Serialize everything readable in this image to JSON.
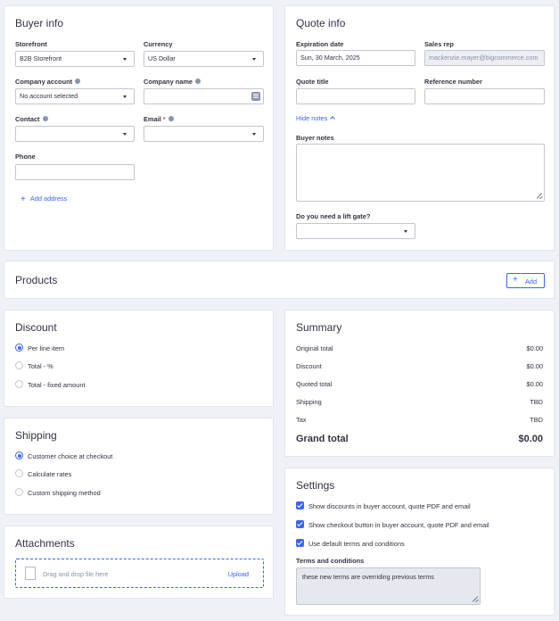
{
  "buyer_info": {
    "title": "Buyer info",
    "storefront": {
      "label": "Storefront",
      "value": "B2B Storefront"
    },
    "currency": {
      "label": "Currency",
      "value": "US Dollar"
    },
    "company_account": {
      "label": "Company account",
      "value": "No account selected"
    },
    "company_name": {
      "label": "Company name",
      "value": ""
    },
    "contact": {
      "label": "Contact",
      "value": ""
    },
    "email": {
      "label": "Email",
      "required_mark": "*",
      "value": ""
    },
    "phone": {
      "label": "Phone",
      "value": ""
    },
    "add_address": "Add address"
  },
  "quote_info": {
    "title": "Quote info",
    "expiration": {
      "label": "Expiration date",
      "value": "Sun, 30 March, 2025"
    },
    "sales_rep": {
      "label": "Sales rep",
      "value": "mackenzie.mayer@bigcommerce.com"
    },
    "quote_title": {
      "label": "Quote title",
      "value": ""
    },
    "reference": {
      "label": "Reference number",
      "value": ""
    },
    "hide_notes": "Hide notes",
    "buyer_notes": {
      "label": "Buyer notes",
      "value": ""
    },
    "lift_gate": {
      "label": "Do you need a lift gate?",
      "value": ""
    }
  },
  "products": {
    "title": "Products",
    "add_label": "Add"
  },
  "discount": {
    "title": "Discount",
    "options": [
      "Per line item",
      "Total - %",
      "Total - fixed amount"
    ],
    "selected": 0
  },
  "summary": {
    "title": "Summary",
    "rows": [
      {
        "label": "Original total",
        "value": "$0.00"
      },
      {
        "label": "Discount",
        "value": "$0.00"
      },
      {
        "label": "Quoted total",
        "value": "$0.00"
      },
      {
        "label": "Shipping",
        "value": "TBD"
      },
      {
        "label": "Tax",
        "value": "TBD"
      }
    ],
    "grand_total": {
      "label": "Grand total",
      "value": "$0.00"
    }
  },
  "shipping": {
    "title": "Shipping",
    "options": [
      "Customer choice at checkout",
      "Calculate rates",
      "Custom shipping method"
    ],
    "selected": 0
  },
  "settings": {
    "title": "Settings",
    "checkboxes": [
      "Show discounts in buyer account, quote PDF and email",
      "Show checkout button in buyer account, quote PDF and email",
      "Use default terms and conditions"
    ],
    "terms": {
      "label": "Terms and conditions",
      "value": "these new terms are overriding previous terms"
    }
  },
  "attachments": {
    "title": "Attachments",
    "drop_text": "Drag and drop file here",
    "upload": "Upload"
  },
  "colors": {
    "accent": "#3c64f4",
    "background": "#eff1f7",
    "text": "#313440",
    "muted": "#8c93ad",
    "border": "#c3c6d1"
  }
}
